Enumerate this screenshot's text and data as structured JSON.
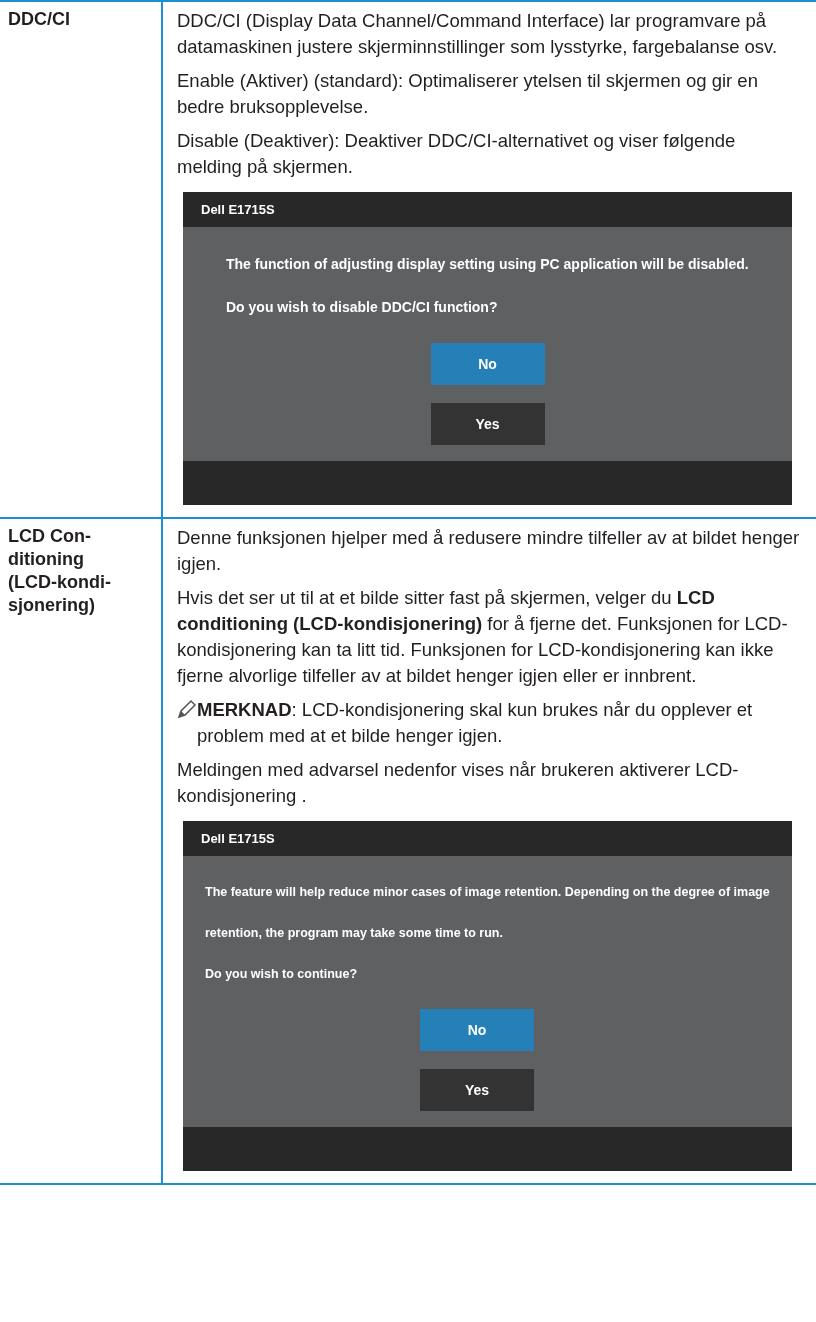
{
  "rows": [
    {
      "term_lines": [
        "DDC/CI"
      ],
      "content": [
        {
          "kind": "paragraph",
          "text": "DDC/CI (Display Data Channel/Command Interface) lar programvare på datamaskinen justere skjerminnstillinger som lysstyrke, fargebalanse osv."
        },
        {
          "kind": "paragraph",
          "text": "Enable (Aktiver) (standard): Optimaliserer ytelsen til skjermen og gir en bedre bruksopplevelse."
        },
        {
          "kind": "paragraph",
          "text": "Disable (Deaktiver): Deaktiver DDC/CI-alternativet og viser følgende melding på skjermen."
        },
        {
          "kind": "dialog",
          "title": "Dell E1715S",
          "messages": [
            "The function of adjusting display setting using PC application will be disabled.",
            "Do you wish to disable DDC/CI function?"
          ],
          "buttons": [
            {
              "label": "No",
              "selected": true
            },
            {
              "label": "Yes",
              "selected": false
            }
          ]
        }
      ]
    },
    {
      "term_lines": [
        "LCD Con-",
        "ditioning",
        "(LCD-kondi-",
        "sjonering)"
      ],
      "content": [
        {
          "kind": "paragraph",
          "text": "Denne funksjonen hjelper med å redusere mindre tilfeller av at bildet henger igjen."
        },
        {
          "kind": "paragraph",
          "text": "Hvis det ser ut til at et bilde sitter fast på skjermen, velger du **LCD conditioning (LCD-kondisjonering)** for å fjerne det. Funksjonen for LCD-kondisjonering kan ta litt tid. Funksjonen for LCD-kondisjonering kan ikke fjerne alvorlige tilfeller av at bildet henger igjen eller er innbrent."
        },
        {
          "kind": "note",
          "text": "**MERKNAD**: LCD-kondisjonering skal kun brukes når du opplever et problem med at et bilde henger igjen."
        },
        {
          "kind": "paragraph",
          "text": "Meldingen med advarsel nedenfor vises når brukeren aktiverer LCD-kondisjonering ."
        },
        {
          "kind": "dialog",
          "title": "Dell E1715S",
          "messages": [
            "The feature will help reduce minor cases of image retention. Depending on the degree of image retention, the program may take some time to run.",
            "Do you wish to continue?"
          ],
          "buttons": [
            {
              "label": "No",
              "selected": true
            },
            {
              "label": "Yes",
              "selected": false
            }
          ]
        }
      ]
    }
  ]
}
